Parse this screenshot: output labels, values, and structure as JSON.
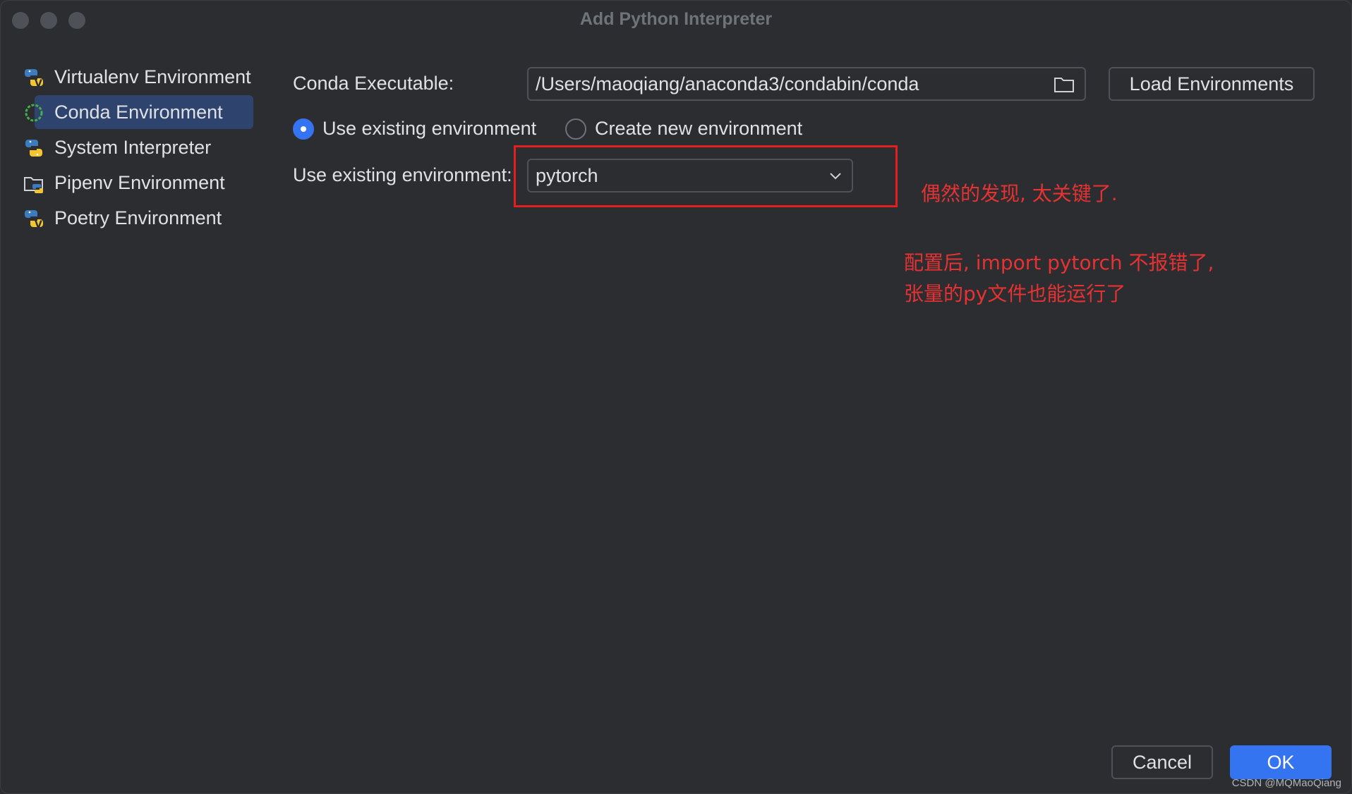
{
  "window": {
    "title": "Add Python Interpreter"
  },
  "sidebar": {
    "items": [
      {
        "label": "Virtualenv Environment",
        "icon": "virtualenv-icon",
        "selected": false
      },
      {
        "label": "Conda Environment",
        "icon": "conda-icon",
        "selected": true
      },
      {
        "label": "System Interpreter",
        "icon": "python-icon",
        "selected": false
      },
      {
        "label": "Pipenv Environment",
        "icon": "pipenv-folder-icon",
        "selected": false
      },
      {
        "label": "Poetry Environment",
        "icon": "poetry-icon",
        "selected": false
      }
    ]
  },
  "conda": {
    "executable_label": "Conda Executable:",
    "executable_value": "/Users/maoqiang/anaconda3/condabin/conda",
    "load_button": "Load Environments",
    "radio_existing": "Use existing environment",
    "radio_new": "Create new environment",
    "existing_label": "Use existing environment:",
    "existing_value": "pytorch"
  },
  "annotations": {
    "note1": "偶然的发现, 太关键了.",
    "note2_line1": "配置后, import pytorch 不报错了,",
    "note2_line2": "张量的py文件也能运行了"
  },
  "footer": {
    "cancel": "Cancel",
    "ok": "OK"
  },
  "watermark": "CSDN @MQMaoQiang",
  "colors": {
    "background": "#2b2d30",
    "accent": "#3574f0",
    "selection": "#2e436e",
    "annotation": "#e32020"
  }
}
